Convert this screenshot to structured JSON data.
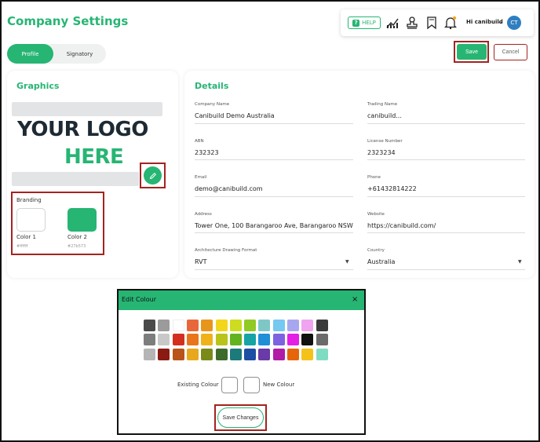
{
  "page_title": "Company Settings",
  "topbar": {
    "help_label": "HELP",
    "help_icon": "?",
    "icons": [
      "chart-icon",
      "stamp-icon",
      "bookmark-icon",
      "bell-icon"
    ],
    "user_greeting": "Hi canibuild",
    "avatar_initials": "CT"
  },
  "tabs": [
    {
      "label": "Profile",
      "active": true
    },
    {
      "label": "Signatory",
      "active": false
    }
  ],
  "actions": {
    "save_label": "Save",
    "cancel_label": "Cancel"
  },
  "graphics": {
    "title": "Graphics",
    "logo_line1": "YOUR LOGO",
    "logo_line2": "HERE",
    "branding": {
      "label": "Branding",
      "colors": [
        {
          "label": "Color 1",
          "hex": "#ffffff"
        },
        {
          "label": "Color 2",
          "hex": "#27b573"
        }
      ]
    }
  },
  "details": {
    "title": "Details",
    "fields": {
      "company_name": {
        "label": "Company Name",
        "value": "Canibuild Demo Australia"
      },
      "trading_name": {
        "label": "Trading Name",
        "value": "canibuild..."
      },
      "abn": {
        "label": "ABN",
        "value": "232323"
      },
      "license_number": {
        "label": "License Number",
        "value": "2323234"
      },
      "email": {
        "label": "Email",
        "value": "demo@canibuild.com"
      },
      "phone": {
        "label": "Phone",
        "value": "+61432814222"
      },
      "address": {
        "label": "Address",
        "value": "Tower One, 100 Barangaroo Ave, Barangaroo NSW"
      },
      "website": {
        "label": "Website",
        "value": "https://canibuild.com/"
      },
      "architecture_format": {
        "label": "Architecture Drawing Format",
        "value": "RVT"
      },
      "country": {
        "label": "Country",
        "value": "Australia"
      }
    }
  },
  "edit_colour_modal": {
    "title": "Edit Colour",
    "close_icon": "×",
    "palette": [
      [
        "#4a4a4a",
        "#9b9b9b",
        "#ffffff",
        "#e8673a",
        "#e8951c",
        "#f3d51a",
        "#cddc1e",
        "#91c925",
        "#7fc7c7",
        "#75c8f0",
        "#a7a7f0",
        "#f0a3ee",
        "#3a3a3a"
      ],
      [
        "#7d7d7d",
        "#c8c8c8",
        "#d32f1e",
        "#e8751c",
        "#f0b21a",
        "#b8c41a",
        "#62b31e",
        "#16a4a4",
        "#1f8fd8",
        "#7d63e0",
        "#e41ee6",
        "#111111",
        "#6b6b6b"
      ],
      [
        "#b5b5b5",
        "#8a1a12",
        "#b9531a",
        "#e8a81c",
        "#7a8a1a",
        "#3d6b2a",
        "#1c7a7a",
        "#1c4ea4",
        "#6a3aa8",
        "#b01ca5",
        "#e7650a",
        "#f5c21a",
        "#7fdcc3"
      ]
    ],
    "existing_label": "Existing Colour",
    "new_label": "New Colour",
    "save_changes_label": "Save Changes"
  }
}
